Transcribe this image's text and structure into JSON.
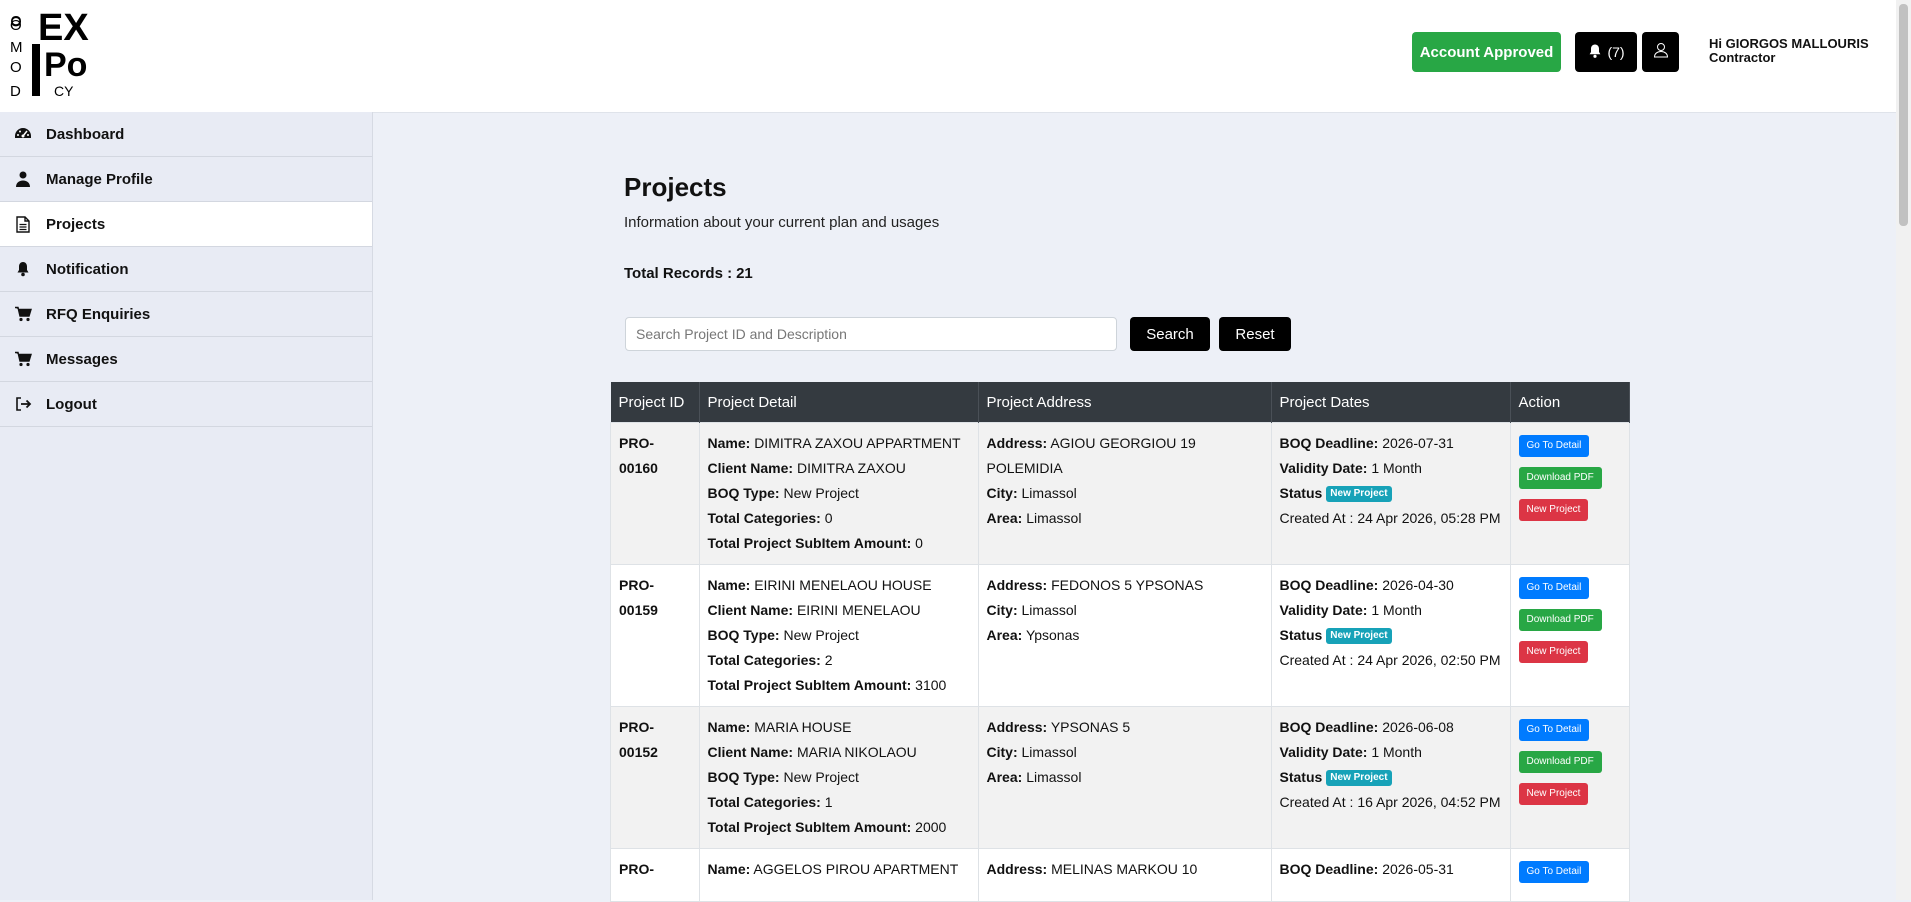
{
  "header": {
    "logo_text": "DOMO EXPO CY",
    "account_status": "Account Approved",
    "notification_count": "(7)",
    "user_greeting": "Hi GIORGOS MALLOURIS",
    "user_role": "Contractor"
  },
  "sidebar": {
    "items": [
      {
        "label": "Dashboard",
        "icon": "dashboard-icon"
      },
      {
        "label": "Manage Profile",
        "icon": "user-icon"
      },
      {
        "label": "Projects",
        "icon": "document-icon",
        "active": true
      },
      {
        "label": "Notification",
        "icon": "bell-icon"
      },
      {
        "label": "RFQ Enquiries",
        "icon": "cart-icon"
      },
      {
        "label": "Messages",
        "icon": "cart-icon"
      },
      {
        "label": "Logout",
        "icon": "logout-icon"
      }
    ]
  },
  "main": {
    "title": "Projects",
    "subtitle": "Information about your current plan and usages",
    "total_label": "Total Records :",
    "total_value": "21",
    "search": {
      "placeholder": "Search Project ID and Description",
      "value": ""
    },
    "search_button": "Search",
    "reset_button": "Reset",
    "table": {
      "headers": [
        "Project ID",
        "Project Detail",
        "Project Address",
        "Project Dates",
        "Action"
      ],
      "labels": {
        "name": "Name:",
        "client": "Client Name:",
        "boq_type": "BOQ Type:",
        "categories": "Total Categories:",
        "amount": "Total Project SubItem Amount:",
        "address": "Address:",
        "city": "City:",
        "area": "Area:",
        "deadline": "BOQ Deadline:",
        "validity": "Validity Date:",
        "status": "Status",
        "created": "Created At :"
      },
      "actions": {
        "detail": "Go To Detail",
        "pdf": "Download PDF",
        "new": "New Project"
      },
      "rows": [
        {
          "id": "PRO-00160",
          "name": "DIMITRA ZAXOU APPARTMENT",
          "client": "DIMITRA ZAXOU",
          "boq_type": "New Project",
          "categories": "0",
          "amount": "0",
          "address": "AGIOU GEORGIOU 19 POLEMIDIA",
          "city": "Limassol",
          "area": "Limassol",
          "deadline": "2026-07-31",
          "validity": "1 Month",
          "status": "New Project",
          "created": "24 Apr 2026, 05:28 PM"
        },
        {
          "id": "PRO-00159",
          "name": "EIRINI MENELAOU HOUSE",
          "client": "EIRINI MENELAOU",
          "boq_type": "New Project",
          "categories": "2",
          "amount": "3100",
          "address": "FEDONOS 5 YPSONAS",
          "city": "Limassol",
          "area": "Ypsonas",
          "deadline": "2026-04-30",
          "validity": "1 Month",
          "status": "New Project",
          "created": "24 Apr 2026, 02:50 PM"
        },
        {
          "id": "PRO-00152",
          "name": "MARIA HOUSE",
          "client": "MARIA NIKOLAOU",
          "boq_type": "New Project",
          "categories": "1",
          "amount": "2000",
          "address": "YPSONAS 5",
          "city": "Limassol",
          "area": "Limassol",
          "deadline": "2026-06-08",
          "validity": "1 Month",
          "status": "New Project",
          "created": "16 Apr 2026, 04:52 PM"
        },
        {
          "id": "PRO-",
          "name": "AGGELOS PIROU APARTMENT",
          "client": "",
          "boq_type": "",
          "categories": "",
          "amount": "",
          "address": "MELINAS MARKOU 10",
          "city": "",
          "area": "",
          "deadline": "2026-05-31",
          "validity": "",
          "status": "",
          "created": ""
        }
      ]
    }
  },
  "colors": {
    "approved_green": "#28a745",
    "table_header": "#343a40",
    "badge_teal": "#17a2b8",
    "btn_blue": "#007bff",
    "btn_red": "#dc3545",
    "page_bg": "#edf0f7"
  }
}
